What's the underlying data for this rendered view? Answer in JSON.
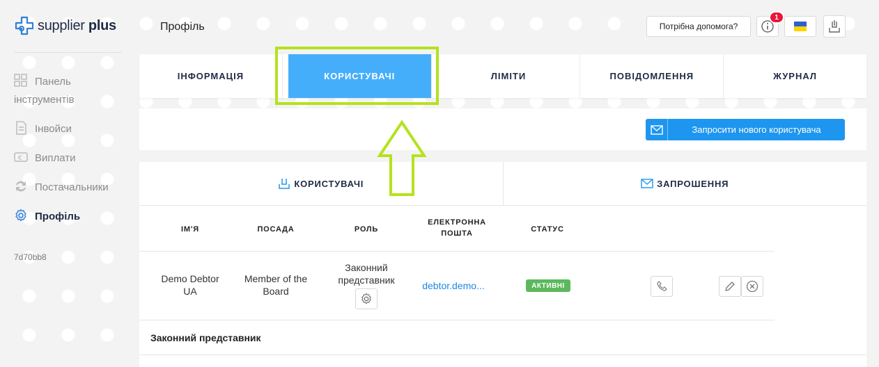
{
  "app": {
    "logo_light": "supplier ",
    "logo_bold": "plus"
  },
  "sidebar": {
    "items": [
      {
        "label": "Панель інструментів",
        "icon": "dashboard-icon",
        "active": false
      },
      {
        "label": "Інвойси",
        "icon": "invoice-icon",
        "active": false
      },
      {
        "label": "Виплати",
        "icon": "payout-icon",
        "active": false
      },
      {
        "label": "Постачальники",
        "icon": "suppliers-icon",
        "active": false
      },
      {
        "label": "Профіль",
        "icon": "gear-icon",
        "active": true
      }
    ],
    "version": "7d70bb8"
  },
  "header": {
    "title": "Профіль",
    "help_label": "Потрібна допомога?",
    "notification_count": "1",
    "language": "UA flag"
  },
  "tabs": [
    {
      "label": "ІНФОРМАЦІЯ",
      "active": false
    },
    {
      "label": "КОРИСТУВАЧІ",
      "active": true
    },
    {
      "label": "ЛІМІТИ",
      "active": false
    },
    {
      "label": "ПОВІДОМЛЕННЯ",
      "active": false
    },
    {
      "label": "ЖУРНАЛ",
      "active": false
    }
  ],
  "actions": {
    "invite_label": "Запросити нового користувача"
  },
  "subtabs": {
    "users_label": "КОРИСТУВАЧІ",
    "invitations_label": "ЗАПРОШЕННЯ"
  },
  "table": {
    "columns": [
      "ІМ'Я",
      "ПОСАДА",
      "РОЛЬ",
      "ЕЛЕКТРОННА ПОШТА",
      "СТАТУС"
    ],
    "rows": [
      {
        "name": "Demo Debtor UA",
        "position": "Member of the Board",
        "role": "Законний представник",
        "email": "debtor.demo...",
        "status": "АКТИВНІ"
      }
    ],
    "group_label": "Законний представник"
  },
  "colors": {
    "accent": "#45aefb",
    "highlight": "#b5e21d",
    "status_active": "#5cb85c",
    "badge": "#e8163a"
  }
}
